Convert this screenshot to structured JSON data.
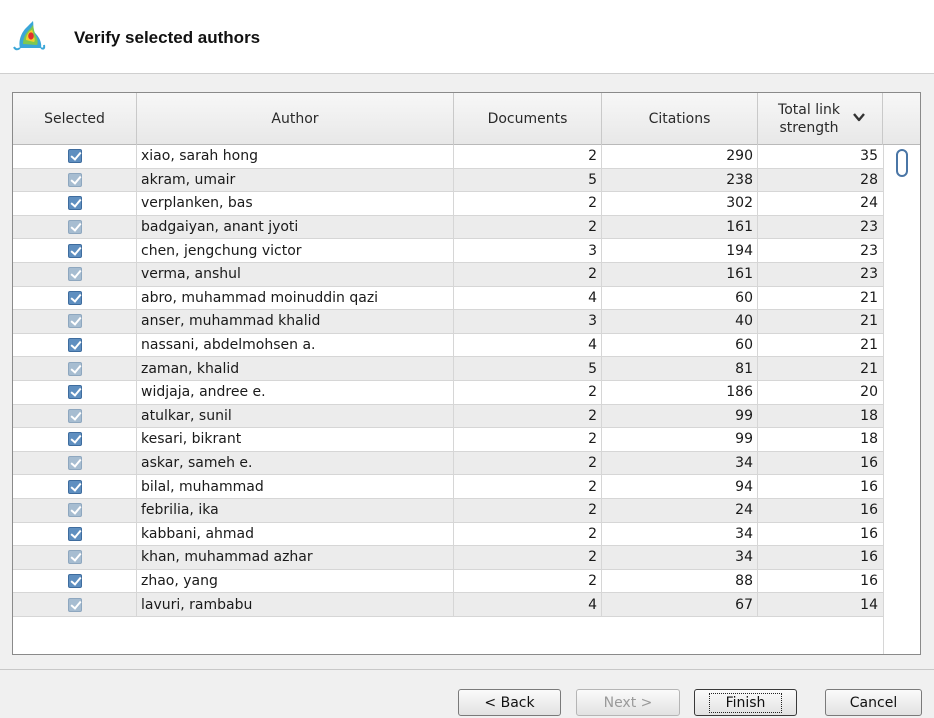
{
  "header": {
    "title": "Verify selected authors",
    "icon": "vosviewer-logo-icon"
  },
  "table": {
    "columns": [
      "Selected",
      "Author",
      "Documents",
      "Citations",
      "Total link strength"
    ],
    "sort": {
      "column": "Total link strength",
      "direction": "descending",
      "icon": "chevron-down-icon"
    },
    "rows": [
      {
        "selected": true,
        "author": "xiao, sarah hong",
        "documents": "2",
        "citations": "290",
        "total_link_strength": "35"
      },
      {
        "selected": true,
        "author": "akram, umair",
        "documents": "5",
        "citations": "238",
        "total_link_strength": "28"
      },
      {
        "selected": true,
        "author": "verplanken, bas",
        "documents": "2",
        "citations": "302",
        "total_link_strength": "24"
      },
      {
        "selected": true,
        "author": "badgaiyan, anant jyoti",
        "documents": "2",
        "citations": "161",
        "total_link_strength": "23"
      },
      {
        "selected": true,
        "author": "chen, jengchung victor",
        "documents": "3",
        "citations": "194",
        "total_link_strength": "23"
      },
      {
        "selected": true,
        "author": "verma, anshul",
        "documents": "2",
        "citations": "161",
        "total_link_strength": "23"
      },
      {
        "selected": true,
        "author": "abro, muhammad moinuddin qazi",
        "documents": "4",
        "citations": "60",
        "total_link_strength": "21"
      },
      {
        "selected": true,
        "author": "anser, muhammad khalid",
        "documents": "3",
        "citations": "40",
        "total_link_strength": "21"
      },
      {
        "selected": true,
        "author": "nassani, abdelmohsen a.",
        "documents": "4",
        "citations": "60",
        "total_link_strength": "21"
      },
      {
        "selected": true,
        "author": "zaman, khalid",
        "documents": "5",
        "citations": "81",
        "total_link_strength": "21"
      },
      {
        "selected": true,
        "author": "widjaja, andree e.",
        "documents": "2",
        "citations": "186",
        "total_link_strength": "20"
      },
      {
        "selected": true,
        "author": "atulkar, sunil",
        "documents": "2",
        "citations": "99",
        "total_link_strength": "18"
      },
      {
        "selected": true,
        "author": "kesari, bikrant",
        "documents": "2",
        "citations": "99",
        "total_link_strength": "18"
      },
      {
        "selected": true,
        "author": "askar, sameh e.",
        "documents": "2",
        "citations": "34",
        "total_link_strength": "16"
      },
      {
        "selected": true,
        "author": "bilal, muhammad",
        "documents": "2",
        "citations": "94",
        "total_link_strength": "16"
      },
      {
        "selected": true,
        "author": "febrilia, ika",
        "documents": "2",
        "citations": "24",
        "total_link_strength": "16"
      },
      {
        "selected": true,
        "author": "kabbani, ahmad",
        "documents": "2",
        "citations": "34",
        "total_link_strength": "16"
      },
      {
        "selected": true,
        "author": "khan, muhammad azhar",
        "documents": "2",
        "citations": "34",
        "total_link_strength": "16"
      },
      {
        "selected": true,
        "author": "zhao, yang",
        "documents": "2",
        "citations": "88",
        "total_link_strength": "16"
      },
      {
        "selected": true,
        "author": "lavuri, rambabu",
        "documents": "4",
        "citations": "67",
        "total_link_strength": "14"
      }
    ]
  },
  "buttons": {
    "back": "< Back",
    "next": "Next >",
    "finish": "Finish",
    "cancel": "Cancel",
    "next_enabled": false
  },
  "colors": {
    "checkbox_checked": "#5f8fc0",
    "scroll_thumb_border": "#4a76a6"
  }
}
